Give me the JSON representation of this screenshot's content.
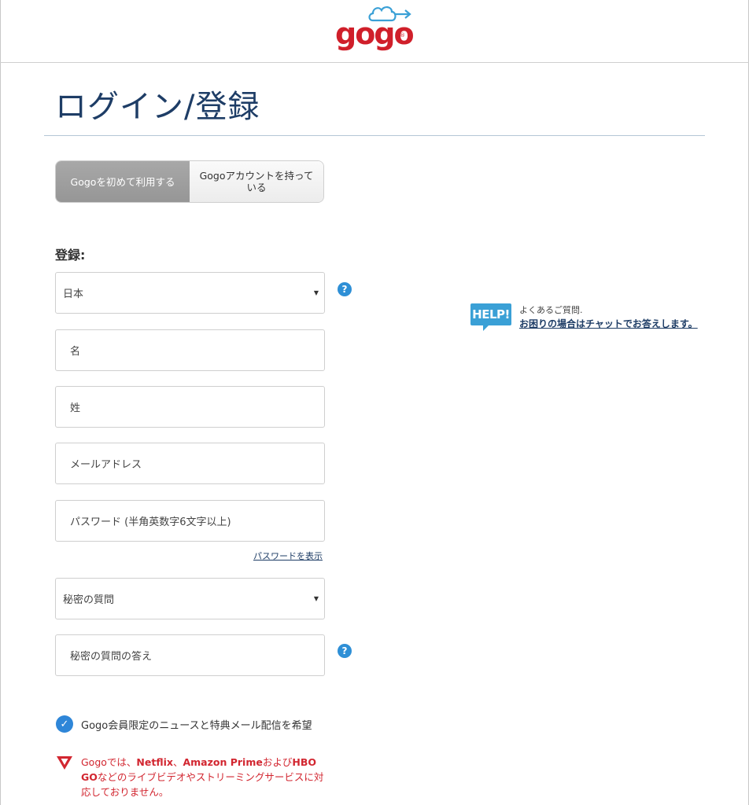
{
  "header": {
    "logo_text": "gogo"
  },
  "page": {
    "title": "ログイン/登録"
  },
  "toggle": {
    "new_user": "Gogoを初めて利用する",
    "existing_user": "Gogoアカウントを持っている"
  },
  "form": {
    "section_label": "登録:",
    "country": "日本",
    "first_name_placeholder": "名",
    "last_name_placeholder": "姓",
    "email_placeholder": "メールアドレス",
    "password_placeholder": "パスワード (半角英数字6文字以上)",
    "show_password": "パスワードを表示",
    "secret_question": "秘密の質問",
    "secret_answer_placeholder": "秘密の質問の答え",
    "optin_label": "Gogo会員限定のニュースと特典メール配信を希望",
    "optin_checked": true
  },
  "help": {
    "badge": "HELP!",
    "faq": "よくあるご質問.",
    "chat": "お困りの場合はチャットでお答えします。"
  },
  "notice": {
    "part1": "Gogoでは、",
    "netflix": "Netflix",
    "sep": "、",
    "amazon": "Amazon Prime",
    "and": "および",
    "hbo": "HBO GO",
    "part2": "などのライブビデオやストリーミングサービスに対応しておりません。"
  },
  "colors": {
    "brand_red": "#d01f2a",
    "title_blue": "#1e3d66",
    "help_blue": "#3aa0d6",
    "check_blue": "#2e86d8",
    "notice_red": "#d22630"
  }
}
